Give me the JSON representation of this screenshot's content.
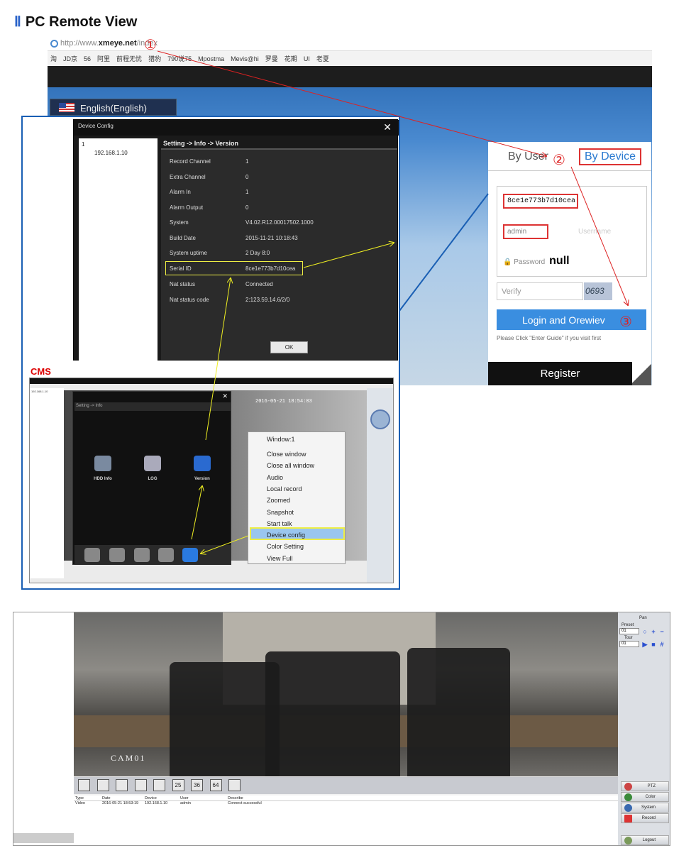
{
  "title": {
    "numeral": "Ⅱ",
    "text": "PC Remote View"
  },
  "browser": {
    "url_prefix": "http://www.",
    "url_domain": "xmeye.net",
    "url_path": "/index",
    "bookmarks": [
      "淘",
      "JD京",
      "56",
      "阿里",
      "前程无忧",
      "猎豹",
      "790说75",
      "Mpostma",
      "Mevis@hi",
      "罗曼",
      "花期",
      "UI",
      "老夏"
    ],
    "language": "English(English)"
  },
  "login": {
    "tabs": [
      "By User",
      "By Device"
    ],
    "serial_value": "8ce1e773b7d10cea",
    "username_value": "admin",
    "username_placeholder": "Username",
    "password_label": "Password",
    "password_note": "null",
    "verify_placeholder": "Verify",
    "captcha": "0693",
    "login_button": "Login and Orewiev",
    "hint": "Please Click \"Enter Guide\" if you visit first",
    "register": "Register"
  },
  "steps": [
    "①",
    "②",
    "③"
  ],
  "device_config": {
    "title": "Device Config",
    "tree_root": "1",
    "tree_device": "192.168.1.10",
    "breadcrumb": "Setting -> Info -> Version",
    "rows": [
      {
        "label": "Record Channel",
        "value": "1"
      },
      {
        "label": "Extra Channel",
        "value": "0"
      },
      {
        "label": "Alarm In",
        "value": "1"
      },
      {
        "label": "Alarm Output",
        "value": "0"
      },
      {
        "label": "System",
        "value": "V4.02.R12.00017502.1000"
      },
      {
        "label": "Build Date",
        "value": "2015-11-21 10:18:43"
      },
      {
        "label": "System uptime",
        "value": "2 Day 8:0"
      },
      {
        "label": "Serial ID",
        "value": "8ce1e773b7d10cea"
      },
      {
        "label": "Nat status",
        "value": "Connected"
      },
      {
        "label": "Nat status code",
        "value": "2:123.59.14.6/2/0"
      }
    ],
    "ok": "OK"
  },
  "cms": {
    "label": "CMS",
    "timestamp": "2016-05-21 18:54:03",
    "setting_breadcrumb": "Setting -> Info",
    "icons": [
      {
        "label": "HDD Info"
      },
      {
        "label": "LOG"
      },
      {
        "label": "Version"
      }
    ],
    "context_menu": {
      "header": "Window:1",
      "items": [
        "Close window",
        "Close all window",
        "Audio",
        "Local record",
        "Zoomed",
        "Snapshot",
        "Start talk",
        "Device config",
        "Color Setting",
        "View Full"
      ],
      "highlighted": "Device config"
    }
  },
  "main_view": {
    "camera_label": "CAM01",
    "ptz": {
      "pan_label": "Pan",
      "preset_label": "Preset",
      "preset_value": "01",
      "tour_label": "Tour",
      "tour_value": "01"
    },
    "layout_buttons": [
      "",
      "",
      "",
      "",
      "",
      "25",
      "36",
      "64",
      ""
    ],
    "log": {
      "columns": [
        "Type",
        "Date",
        "Device",
        "User",
        "Describe"
      ],
      "rows": [
        [
          "Video",
          "2016-05-21 18:53:19",
          "192.168.1.10",
          "admin",
          "Connect successful"
        ]
      ]
    },
    "side_buttons": [
      "PTZ",
      "Color",
      "System",
      "Record",
      "Logout"
    ]
  },
  "colors": {
    "accent_blue": "#3a8ee0",
    "highlight_red": "#dd3333",
    "highlight_yellow": "#eeee44",
    "frame_blue": "#1a5fb4"
  }
}
